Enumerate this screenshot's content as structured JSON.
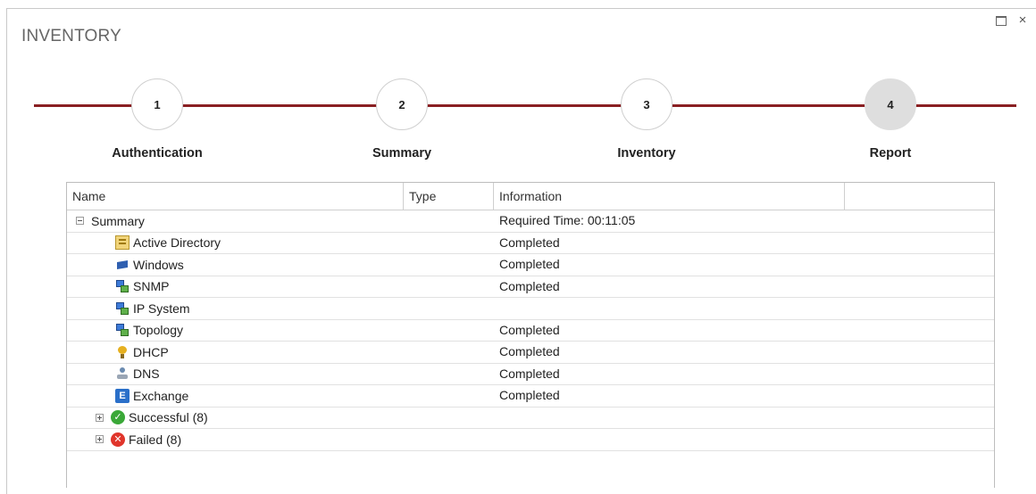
{
  "window": {
    "title": "INVENTORY",
    "maximize_glyph": "",
    "close_glyph": "×"
  },
  "wizard": {
    "steps": [
      {
        "number": "1",
        "label": "Authentication",
        "active": false
      },
      {
        "number": "2",
        "label": "Summary",
        "active": false
      },
      {
        "number": "3",
        "label": "Inventory",
        "active": false
      },
      {
        "number": "4",
        "label": "Report",
        "active": true
      }
    ],
    "accent_color": "#8a1f22"
  },
  "grid": {
    "columns": [
      "Name",
      "Type",
      "Information",
      ""
    ],
    "summary": {
      "label": "Summary",
      "info": "Required Time: 00:11:05",
      "expanded": true
    },
    "items": [
      {
        "label": "Active Directory",
        "icon": "active-directory-icon",
        "info": "Completed"
      },
      {
        "label": "Windows",
        "icon": "windows-icon",
        "info": "Completed"
      },
      {
        "label": "SNMP",
        "icon": "network-icon",
        "info": "Completed"
      },
      {
        "label": "IP System",
        "icon": "network-icon",
        "info": ""
      },
      {
        "label": "Topology",
        "icon": "network-icon",
        "info": "Completed"
      },
      {
        "label": "DHCP",
        "icon": "dhcp-icon",
        "info": "Completed"
      },
      {
        "label": "DNS",
        "icon": "dns-icon",
        "info": "Completed"
      },
      {
        "label": "Exchange",
        "icon": "exchange-icon",
        "info": "Completed"
      }
    ],
    "groups": [
      {
        "label": "Successful (8)",
        "icon": "check-circle-icon",
        "glyph": "✓",
        "expanded": false
      },
      {
        "label": "Failed (8)",
        "icon": "x-circle-icon",
        "glyph": "✕",
        "expanded": false
      }
    ]
  }
}
